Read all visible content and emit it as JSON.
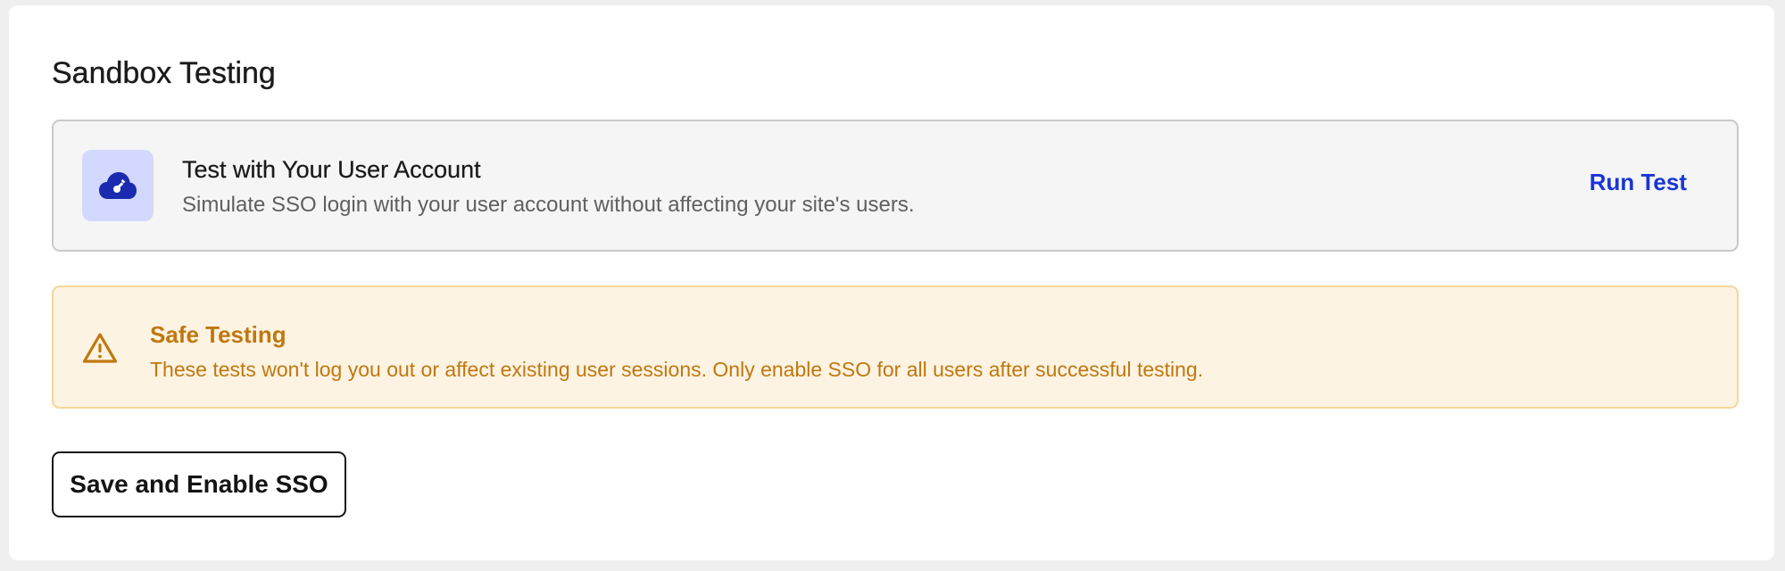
{
  "section": {
    "title": "Sandbox Testing"
  },
  "test_card": {
    "icon": "cloud-key-icon",
    "title": "Test with Your User Account",
    "description": "Simulate SSO login with your user account without affecting your site's users.",
    "action_label": "Run Test"
  },
  "alert": {
    "icon": "warning-triangle-icon",
    "title": "Safe Testing",
    "message": "These tests won't log you out or affect existing user sessions. Only enable SSO for all users after successful testing."
  },
  "footer": {
    "save_label": "Save and Enable SSO"
  },
  "colors": {
    "accent_blue": "#1836d6",
    "icon_tile_bg": "#d3d8ff",
    "icon_fill": "#1a2bb0",
    "warning_text": "#c0780e",
    "warning_bg": "#fdf3e3",
    "warning_border": "#f6d697"
  }
}
